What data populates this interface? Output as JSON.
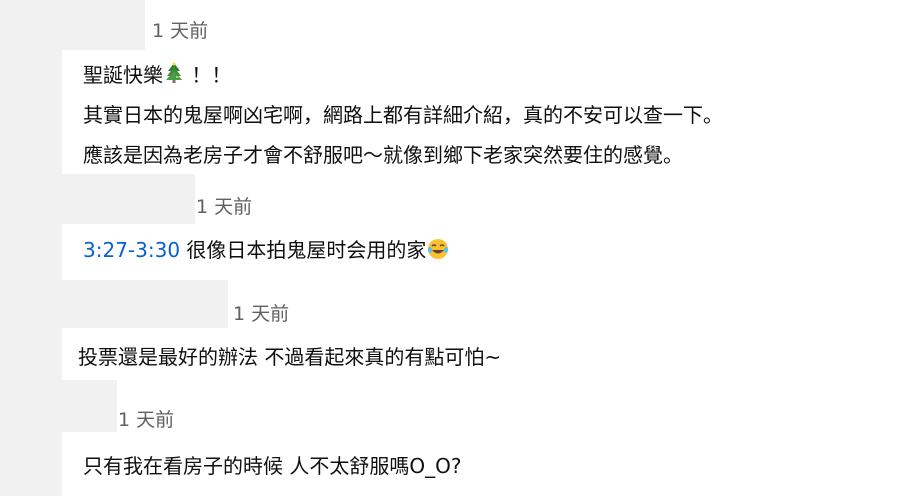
{
  "comments": [
    {
      "timestamp": "1 天前",
      "line1_text": "聖誕快樂",
      "line1_icon": "christmas-tree-icon",
      "line1_after": " ！！",
      "line2": "其實日本的鬼屋啊凶宅啊，網路上都有詳細介紹，真的不安可以查一下。",
      "line3": "應該是因為老房子才會不舒服吧～就像到鄉下老家突然要住的感覺。"
    },
    {
      "timestamp": "1 天前",
      "time_link": "3:27-3:30",
      "text": " 很像日本拍鬼屋时会用的家",
      "icon": "tears-of-joy-emoji-icon"
    },
    {
      "timestamp": "1 天前",
      "text": "投票還是最好的辦法 不過看起來真的有點可怕~"
    },
    {
      "timestamp": "1 天前",
      "text": "只有我在看房子的時候 人不太舒服嗎O_O?"
    }
  ],
  "colors": {
    "background": "#f1f1f1",
    "card": "#ffffff",
    "text": "#0f0f0f",
    "meta": "#606060",
    "link": "#065fd4"
  }
}
